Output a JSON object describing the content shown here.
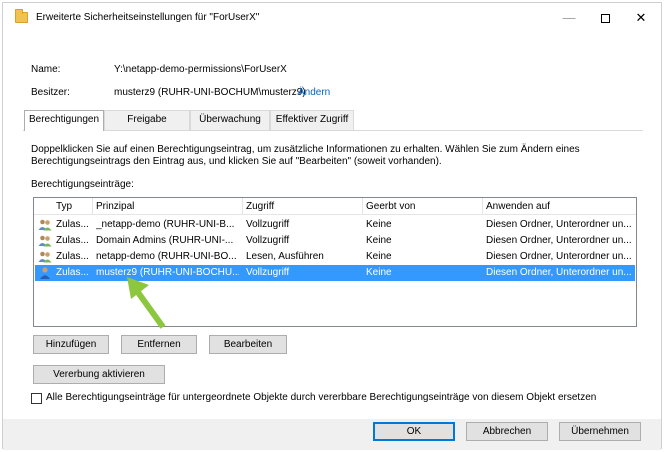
{
  "window": {
    "title": "Erweiterte Sicherheitseinstellungen für \"ForUserX\"",
    "minimize_glyph": "—",
    "close_glyph": "✕"
  },
  "info": {
    "name_label": "Name:",
    "name_value": "Y:\\netapp-demo-permissions\\ForUserX",
    "owner_label": "Besitzer:",
    "owner_value": "musterz9 (RUHR-UNI-BOCHUM\\musterz9)",
    "change_link": "Ändern"
  },
  "tabs": [
    {
      "label": "Berechtigungen",
      "active": true
    },
    {
      "label": "Freigabe",
      "active": false
    },
    {
      "label": "Überwachung",
      "active": false
    },
    {
      "label": "Effektiver Zugriff",
      "active": false
    }
  ],
  "description": {
    "line1": "Doppelklicken Sie auf einen Berechtigungseintrag, um zusätzliche Informationen zu erhalten. Wählen Sie zum Ändern eines",
    "line2": "Berechtigungseintrags den Eintrag aus, und klicken Sie auf \"Bearbeiten\" (soweit vorhanden)."
  },
  "entries_label": "Berechtigungseinträge:",
  "table": {
    "columns": [
      "Typ",
      "Prinzipal",
      "Zugriff",
      "Geerbt von",
      "Anwenden auf"
    ],
    "rows": [
      {
        "type": "Zulas...",
        "principal": "_netapp-demo (RUHR-UNI-B...",
        "access": "Vollzugriff",
        "inherited": "Keine",
        "applies": "Diesen Ordner, Unterordner un...",
        "icon": "group-icon",
        "selected": false
      },
      {
        "type": "Zulas...",
        "principal": "Domain Admins (RUHR-UNI-...",
        "access": "Vollzugriff",
        "inherited": "Keine",
        "applies": "Diesen Ordner, Unterordner un...",
        "icon": "group-icon",
        "selected": false
      },
      {
        "type": "Zulas...",
        "principal": "netapp-demo (RUHR-UNI-BO...",
        "access": "Lesen, Ausführen",
        "inherited": "Keine",
        "applies": "Diesen Ordner, Unterordner un...",
        "icon": "group-icon",
        "selected": false
      },
      {
        "type": "Zulas...",
        "principal": "musterz9 (RUHR-UNI-BOCHU...",
        "access": "Vollzugriff",
        "inherited": "Keine",
        "applies": "Diesen Ordner, Unterordner un...",
        "icon": "user-icon",
        "selected": true
      }
    ]
  },
  "buttons": {
    "add": "Hinzufügen",
    "remove": "Entfernen",
    "edit": "Bearbeiten",
    "enable_inheritance": "Vererbung aktivieren",
    "ok": "OK",
    "cancel": "Abbrechen",
    "apply": "Übernehmen"
  },
  "replace_checkbox": {
    "label": "Alle Berechtigungseinträge für untergeordnete Objekte durch vererbbare Berechtigungseinträge von diesem Objekt ersetzen",
    "checked": false
  },
  "colors": {
    "selection": "#3399ff",
    "link": "#0066cc",
    "arrow": "#8dc63f",
    "default_button_border": "#0078d7"
  }
}
